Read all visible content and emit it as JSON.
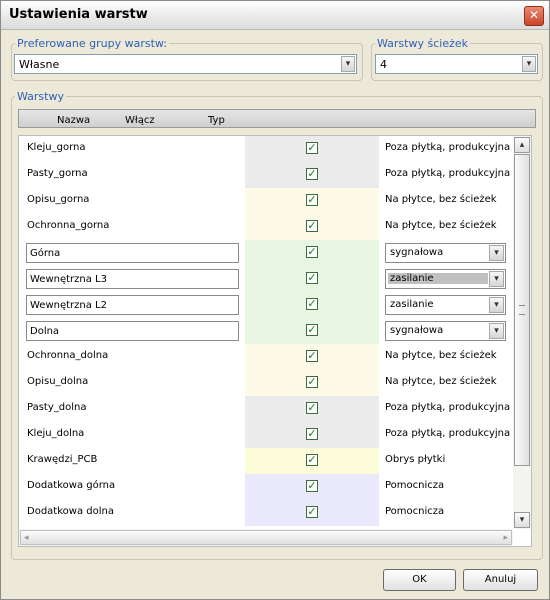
{
  "window": {
    "title": "Ustawienia warstw",
    "close_glyph": "✕"
  },
  "groups": {
    "preferred": {
      "legend": "Preferowane grupy warstw:",
      "value": "Własne"
    },
    "paths": {
      "legend": "Warstwy ścieżek",
      "value": "4"
    },
    "layers": {
      "legend": "Warstwy"
    }
  },
  "table": {
    "columns": [
      "Nazwa",
      "Włącz",
      "Typ"
    ],
    "rows": [
      {
        "name": "Kleju_gorna",
        "editable": false,
        "checked": "✓",
        "type": "Poza płytką, produkcyjna",
        "type_editable": false,
        "bg": "#ececec"
      },
      {
        "name": "Pasty_gorna",
        "editable": false,
        "checked": "✓",
        "type": "Poza płytką, produkcyjna",
        "type_editable": false,
        "bg": "#ececec"
      },
      {
        "name": "Opisu_gorna",
        "editable": false,
        "checked": "✓",
        "type": "Na płytce, bez ścieżek",
        "type_editable": false,
        "bg": "#fdfbe8"
      },
      {
        "name": "Ochronna_gorna",
        "editable": false,
        "checked": "✓",
        "type": "Na płytce, bez ścieżek",
        "type_editable": false,
        "bg": "#fdfbe8"
      },
      {
        "name": "Górna",
        "editable": true,
        "checked": "✓",
        "type": "sygnałowa",
        "type_editable": true,
        "bg": "#e8f7e4"
      },
      {
        "name": "Wewnętrzna L3",
        "editable": true,
        "checked": "✓",
        "type": "zasilanie",
        "type_editable": true,
        "type_selected": true,
        "bg": "#e8f7e4"
      },
      {
        "name": "Wewnętrzna L2",
        "editable": true,
        "checked": "✓",
        "type": "zasilanie",
        "type_editable": true,
        "bg": "#e8f7e4"
      },
      {
        "name": "Dolna",
        "editable": true,
        "checked": "✓",
        "type": "sygnałowa",
        "type_editable": true,
        "bg": "#e8f7e4"
      },
      {
        "name": "Ochronna_dolna",
        "editable": false,
        "checked": "✓",
        "type": "Na płytce, bez ścieżek",
        "type_editable": false,
        "bg": "#fdfbe8"
      },
      {
        "name": "Opisu_dolna",
        "editable": false,
        "checked": "✓",
        "type": "Na płytce, bez ścieżek",
        "type_editable": false,
        "bg": "#fdfbe8"
      },
      {
        "name": "Pasty_dolna",
        "editable": false,
        "checked": "✓",
        "type": "Poza płytką, produkcyjna",
        "type_editable": false,
        "bg": "#ececec"
      },
      {
        "name": "Kleju_dolna",
        "editable": false,
        "checked": "✓",
        "type": "Poza płytką, produkcyjna",
        "type_editable": false,
        "bg": "#ececec"
      },
      {
        "name": "Krawędzi_PCB",
        "editable": false,
        "checked": "✓",
        "type": "Obrys płytki",
        "type_editable": false,
        "bg": "#fcfcd8"
      },
      {
        "name": "Dodatkowa górna",
        "editable": false,
        "checked": "✓",
        "type": "Pomocnicza",
        "type_editable": false,
        "bg": "#eae9fb"
      },
      {
        "name": "Dodatkowa dolna",
        "editable": false,
        "checked": "✓",
        "type": "Pomocnicza",
        "type_editable": false,
        "bg": "#eae9fb"
      }
    ]
  },
  "glyphs": {
    "dropdown": "▾",
    "scroll_up": "▴",
    "scroll_down": "▾",
    "scroll_left": "◂",
    "scroll_right": "▸"
  },
  "buttons": {
    "ok": "OK",
    "cancel": "Anuluj"
  }
}
